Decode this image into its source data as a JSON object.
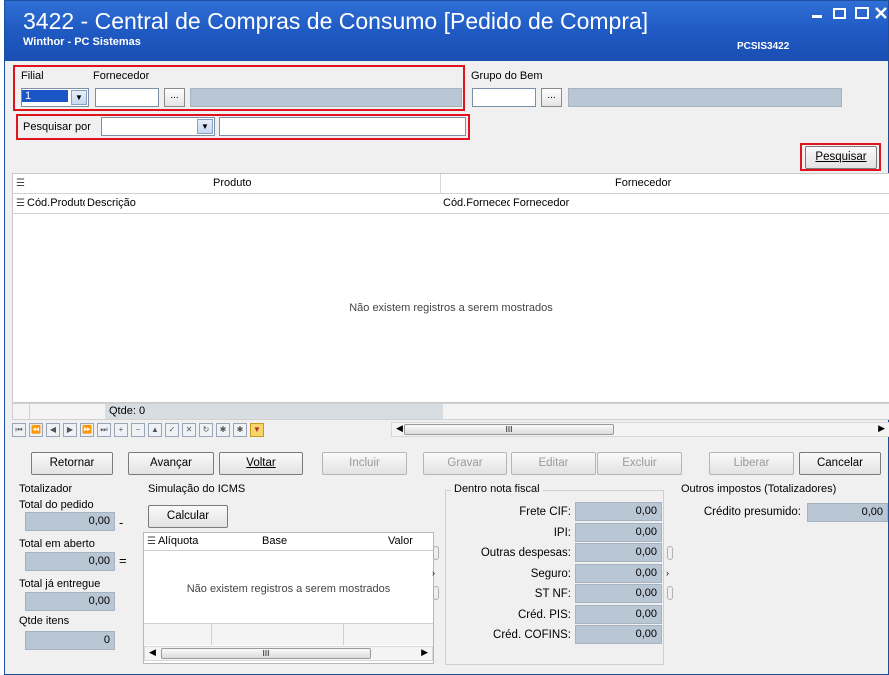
{
  "window": {
    "title": "3422 - Central de Compras de Consumo [Pedido de Compra]",
    "subtitle": "Winthor - PC Sistemas",
    "code": "PCSIS3422",
    "controls": {
      "minimize": "▬",
      "maximize": "□",
      "close": "✕"
    }
  },
  "filters": {
    "filial_label": "Filial",
    "filial_value": "1",
    "fornecedor_label": "Fornecedor",
    "grupo_label": "Grupo do Bem",
    "pesquisar_por_label": "Pesquisar por",
    "ellipsis": "...",
    "search_button": "Pesquisar"
  },
  "grid": {
    "group_produto": "Produto",
    "group_fornecedor": "Fornecedor",
    "columns": [
      "Cód.Produto",
      "Descrição",
      "Cód.Fornecedor",
      "Fornecedor"
    ],
    "empty_message": "Não existem registros a serem mostrados",
    "qtde": "Qtde: 0",
    "scroll_mid": "III"
  },
  "nav_buttons": [
    "⏮",
    "⏪",
    "◀",
    "▶",
    "⏩",
    "⏭",
    "+",
    "−",
    "▲",
    "✓",
    "✕",
    "↻",
    "✱",
    "✱",
    "▼"
  ],
  "actions": {
    "retornar": "Retornar",
    "avancar": "Avançar",
    "voltar": "Voltar",
    "incluir": "Incluir",
    "gravar": "Gravar",
    "editar": "Editar",
    "excluir": "Excluir",
    "liberar": "Liberar",
    "cancelar": "Cancelar"
  },
  "totalizador": {
    "title": "Totalizador",
    "total_pedido_label": "Total do pedido",
    "total_pedido": "0,00",
    "minus": "-",
    "total_aberto_label": "Total em aberto",
    "total_aberto": "0,00",
    "equals": "=",
    "total_entregue_label": "Total já entregue",
    "total_entregue": "0,00",
    "qtde_itens_label": "Qtde itens",
    "qtde_itens": "0"
  },
  "icms": {
    "title": "Simulação do ICMS",
    "calcular": "Calcular",
    "columns": [
      "Alíquota",
      "Base",
      "Valor"
    ],
    "empty_message": "Não existem registros a serem mostrados",
    "scroll_mid": "III"
  },
  "nota_fiscal": {
    "title": "Dentro nota fiscal",
    "rows": [
      {
        "label": "Frete CIF:",
        "value": "0,00"
      },
      {
        "label": "IPI:",
        "value": "0,00"
      },
      {
        "label": "Outras despesas:",
        "value": "0,00"
      },
      {
        "label": "Seguro:",
        "value": "0,00"
      },
      {
        "label": "ST NF:",
        "value": "0,00"
      },
      {
        "label": "Créd. PIS:",
        "value": "0,00"
      },
      {
        "label": "Créd. COFINS:",
        "value": "0,00"
      }
    ]
  },
  "outros": {
    "title": "Outros impostos (Totalizadores)",
    "credito_label": "Crédito presumido:",
    "credito_value": "0,00"
  }
}
